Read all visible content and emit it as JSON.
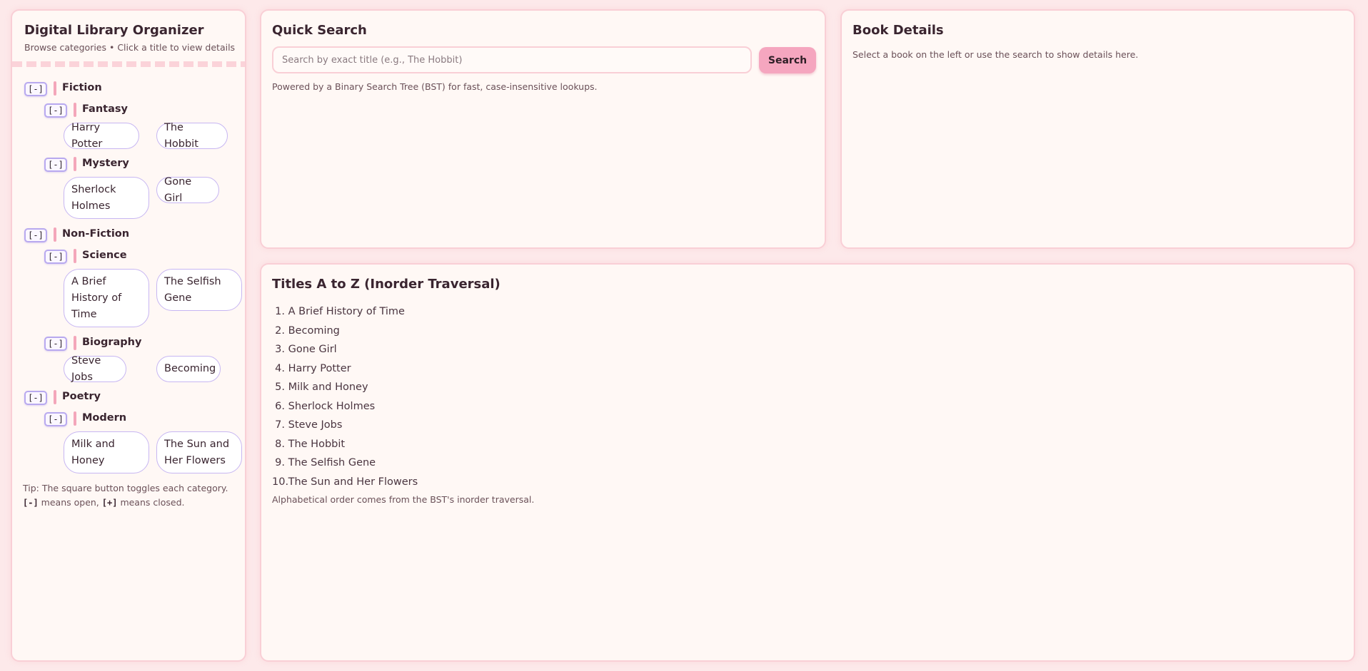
{
  "sidebar": {
    "title": "Digital Library Organizer",
    "subtitle": "Browse categories • Click a title to view details",
    "toggle_open_label": "[-]",
    "categories": [
      {
        "label": "Fiction",
        "subcategories": [
          {
            "label": "Fantasy",
            "books": [
              "Harry Potter",
              "The Hobbit"
            ]
          },
          {
            "label": "Mystery",
            "books": [
              "Sherlock Holmes",
              "Gone Girl"
            ]
          }
        ]
      },
      {
        "label": "Non-Fiction",
        "subcategories": [
          {
            "label": "Science",
            "books": [
              "A Brief History of Time",
              "The Selfish Gene"
            ]
          },
          {
            "label": "Biography",
            "books": [
              "Steve Jobs",
              "Becoming"
            ]
          }
        ]
      },
      {
        "label": "Poetry",
        "subcategories": [
          {
            "label": "Modern",
            "books": [
              "Milk and Honey",
              "The Sun and Her Flowers"
            ]
          }
        ]
      }
    ],
    "tip": {
      "prefix": "Tip: The square button toggles each category.",
      "open_symbol": "[-]",
      "open_text": "means open,",
      "closed_symbol": "[+]",
      "closed_text": "means closed."
    }
  },
  "search": {
    "title": "Quick Search",
    "placeholder": "Search by exact title (e.g., The Hobbit)",
    "value": "",
    "button_label": "Search",
    "note": "Powered by a Binary Search Tree (BST) for fast, case-insensitive lookups."
  },
  "details": {
    "title": "Book Details",
    "empty_text": "Select a book on the left or use the search to show details here."
  },
  "az": {
    "title": "Titles A to Z (Inorder Traversal)",
    "items": [
      "A Brief History of Time",
      "Becoming",
      "Gone Girl",
      "Harry Potter",
      "Milk and Honey",
      "Sherlock Holmes",
      "Steve Jobs",
      "The Hobbit",
      "The Selfish Gene",
      "The Sun and Her Flowers"
    ],
    "note": "Alphabetical order comes from the BST's inorder traversal."
  },
  "colors": {
    "background": "#fde9ea",
    "panel": "#fff8f5",
    "panel_border": "#f9cfd6",
    "accent_pink": "#f5a6bf",
    "category_bar": "#f4a6ba",
    "chip_border": "#c7b6f2"
  }
}
